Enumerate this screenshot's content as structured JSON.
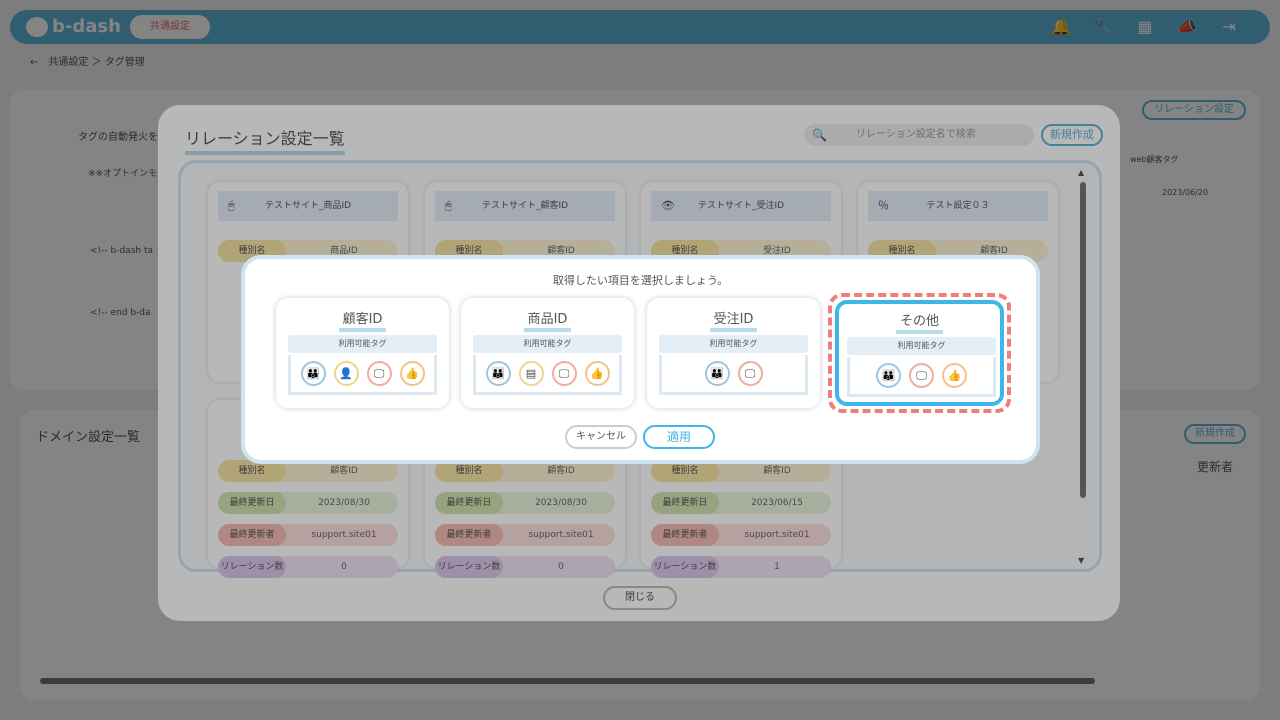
{
  "header": {
    "logo": "b-dash",
    "common_settings": "共通設定",
    "icons": [
      "bell-icon",
      "wrench-icon",
      "grid-icon",
      "megaphone-icon",
      "logout-icon"
    ]
  },
  "breadcrumb": {
    "text": "←　共通設定 ＞ タグ管理"
  },
  "background": {
    "auto_fire": "タグの自動発火を",
    "opt_in": "※※オプトインモ",
    "code_lines": [
      "<!-- b-dash ta",
      "<!-- end b-da"
    ],
    "relation_settings_button": "リレーション設定",
    "web_tag": "web顧客タグ",
    "date": "2023/06/20",
    "domain_list": "ドメイン設定一覧",
    "new_button": "新規作成",
    "updater": "更新者"
  },
  "relation_modal": {
    "title": "リレーション設定一覧",
    "search_placeholder": "リレーション設定名で検索",
    "new_button": "新規作成",
    "close_button": "閉じる",
    "cards": [
      {
        "title": "テストサイト_商品ID",
        "icon": "mouse-icon",
        "rows": [
          {
            "k": "種別名",
            "v": "商品ID"
          }
        ]
      },
      {
        "title": "テストサイト_顧客ID",
        "icon": "mouse-icon",
        "rows": [
          {
            "k": "種別名",
            "v": "顧客ID"
          }
        ]
      },
      {
        "title": "テストサイト_受注ID",
        "icon": "eye-icon",
        "rows": [
          {
            "k": "種別名",
            "v": "受注ID"
          }
        ]
      },
      {
        "title": "テスト設定０３",
        "icon": "percent-icon",
        "rows": [
          {
            "k": "種別名",
            "v": "顧客ID"
          }
        ]
      }
    ],
    "bottom_cards": [
      {
        "rows": [
          {
            "k": "種別名",
            "v": "顧客ID"
          },
          {
            "k": "最終更新日",
            "v": "2023/08/30"
          },
          {
            "k": "最終更新者",
            "v": "support.site01"
          },
          {
            "k": "リレーション数",
            "v": "0"
          }
        ]
      },
      {
        "rows": [
          {
            "k": "種別名",
            "v": "顧客ID"
          },
          {
            "k": "最終更新日",
            "v": "2023/08/30"
          },
          {
            "k": "最終更新者",
            "v": "support.site01"
          },
          {
            "k": "リレーション数",
            "v": "0"
          }
        ]
      },
      {
        "rows": [
          {
            "k": "種別名",
            "v": "顧客ID"
          },
          {
            "k": "最終更新日",
            "v": "2023/06/15"
          },
          {
            "k": "最終更新者",
            "v": "support.site01"
          },
          {
            "k": "リレーション数",
            "v": "1"
          }
        ]
      }
    ]
  },
  "select_modal": {
    "prompt": "取得したい項目を選択しましょう。",
    "tag_header": "利用可能タグ",
    "options": [
      {
        "title": "顧客ID",
        "icons": [
          {
            "glyph": "👪",
            "c": "b"
          },
          {
            "glyph": "👤",
            "c": "y"
          },
          {
            "glyph": "🖵",
            "c": "r"
          },
          {
            "glyph": "👍",
            "c": "o"
          }
        ]
      },
      {
        "title": "商品ID",
        "icons": [
          {
            "glyph": "👪",
            "c": "b"
          },
          {
            "glyph": "▤",
            "c": "y"
          },
          {
            "glyph": "🖵",
            "c": "r"
          },
          {
            "glyph": "👍",
            "c": "o"
          }
        ]
      },
      {
        "title": "受注ID",
        "icons": [
          {
            "glyph": "👪",
            "c": "b"
          },
          {
            "glyph": "🖵",
            "c": "r"
          }
        ]
      },
      {
        "title": "その他",
        "icons": [
          {
            "glyph": "👪",
            "c": "b"
          },
          {
            "glyph": "🖵",
            "c": "r"
          },
          {
            "glyph": "👍",
            "c": "o"
          }
        ],
        "selected": true
      }
    ],
    "cancel_button": "キャンセル",
    "apply_button": "適用"
  }
}
